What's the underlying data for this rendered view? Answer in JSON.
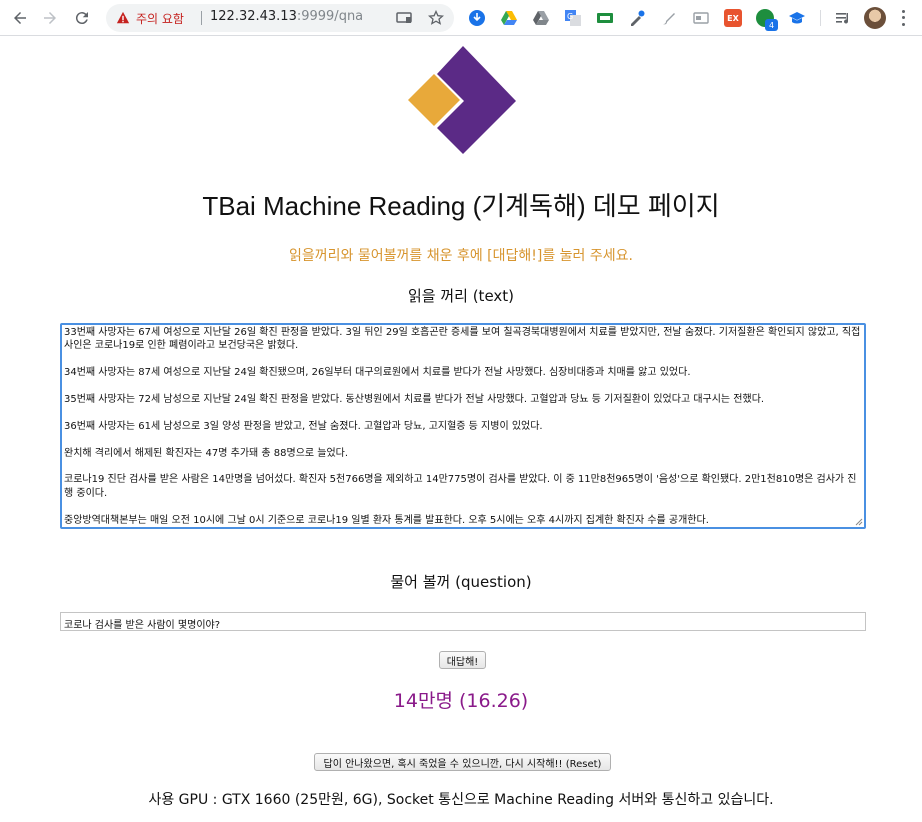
{
  "browser": {
    "security_label": "주의 요함",
    "url_host": "122.32.43.13",
    "url_rest": ":9999/qna",
    "notification_count": "4",
    "ext_label": "EX"
  },
  "page": {
    "title": "TBai Machine Reading (기계독해) 데모 페이지",
    "instruction": "읽을꺼리와 물어볼꺼를 채운 후에 [대답해!]를 눌러 주세요.",
    "text_label": "읽을 꺼리 (text)",
    "text_paragraphs": [
      "33번째 사망자는 67세 여성으로 지난달 26일 확진 판정을 받았다. 3일 뒤인 29일 호흡곤란 증세를 보여 칠곡경북대병원에서 치료를 받았지만, 전날 숨졌다. 기저질환은 확인되지 않았고, 직접 사인은 코로나19로 인한 폐렴이라고 보건당국은 밝혔다.",
      "34번째 사망자는 87세 여성으로 지난달 24일 확진됐으며, 26일부터 대구의료원에서 치료를 받다가 전날 사망했다. 심장비대증과 치매를 앓고 있었다.",
      "35번째 사망자는 72세 남성으로 지난달 24일 확진 판정을 받았다. 동산병원에서 치료를 받다가 전날 사망했다. 고혈압과 당뇨 등 기저질환이 있었다고 대구시는 전했다.",
      "36번째 사망자는 61세 남성으로 3일 양성 판정을 받았고, 전날 숨졌다. 고혈압과 당뇨, 고지혈증 등 지병이 있었다.",
      "완치해 격리에서 해제된 확진자는 47명 추가돼 총 88명으로 늘었다.",
      "코로나19 진단 검사를 받은 사람은 14만명을 넘어섰다. 확진자 5천766명을 제외하고 14만775명이 검사를 받았다. 이 중 11만8천965명이 '음성'으로 확인됐다. 2만1천810명은 검사가 진행 중이다.",
      "중앙방역대책본부는 매일 오전 10시에 그날 0시 기준으로 코로나19 일별 환자 통계를 발표한다. 오후 5시에는 오후 4시까지 집계한 확진자 수를 공개한다."
    ],
    "question_label": "물어 볼꺼 (question)",
    "question_value": "코로나 검사를 받은 사람이 몇명이야?",
    "answer_button": "대답해!",
    "answer": "14만명 (16.26)",
    "reset_button": "답이 안나왔으면, 혹시 죽었을 수 있으니깐, 다시 시작해!! (Reset)",
    "footer": "사용 GPU : GTX 1660 (25만원, 6G), Socket 통신으로 Machine Reading 서버와 통신하고 있습니다."
  },
  "colors": {
    "logo_purple": "#5b2a86",
    "logo_orange": "#e8a93a",
    "instruction": "#d7952f",
    "answer": "#8a1a8a",
    "focus_border": "#4a90e2"
  }
}
